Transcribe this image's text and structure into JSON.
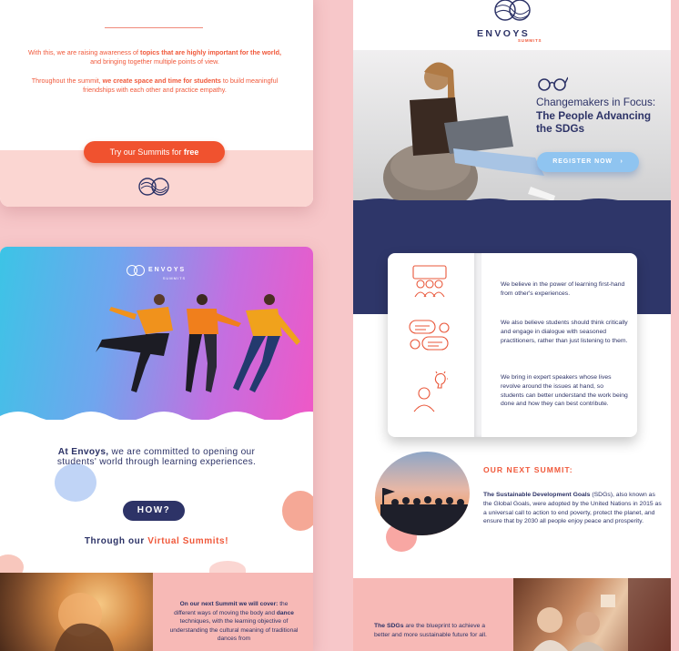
{
  "left_top": {
    "para1_pre": "With this, we are raising awareness of ",
    "para1_bold": "topics that are highly important for the world,",
    "para1_post": " and bringing together multiple points of view.",
    "para2_pre": "Throughout the summit, ",
    "para2_bold": "we create space and time for students",
    "para2_post": " to build meaningful friendships with each other and practice empathy.",
    "cta_pre": "Try our Summits for ",
    "cta_bold": "free"
  },
  "left_bottom": {
    "hero_brand": "ENVOYS",
    "hero_brand_sub": "SUMMITS",
    "committed_bold": "At Envoys,",
    "committed_rest": " we are committed to opening our students' world through learning experiences.",
    "how_label": "HOW?",
    "through_pre": "Through our ",
    "through_accent": "Virtual Summits!",
    "bottom_bold": "On our next Summit we will cover:",
    "bottom_pre": " the different ways of moving the body and ",
    "bottom_bold2": "dance",
    "bottom_post": " techniques, with the learning objective of understanding the cultural meaning of traditional dances from"
  },
  "right": {
    "brand": "ENVOYS",
    "brand_sub": "SUMMITS",
    "title_line": "Changemakers in Focus: ",
    "title_bold": "The People Advancing the SDGs",
    "register_label": "REGISTER NOW",
    "register_arrow": "›",
    "info_items": [
      "We believe in the power of learning first-hand from other's experiences.",
      "We also believe students should think critically and engage in dialogue with seasoned practitioners, rather than just listening to them.",
      "We bring in expert speakers whose lives revolve around the issues at hand, so students can better understand the work being done and how they can best contribute."
    ],
    "next_heading": "OUR NEXT SUMMIT:",
    "next_bold": "The Sustainable Development Goals",
    "next_rest": " (SDGs), also known as the Global Goals, were adopted by the United Nations in 2015 as a universal call to action to end poverty, protect the planet, and ensure that by 2030 all people enjoy peace and prosperity.",
    "sdgs_bold": "The SDGs",
    "sdgs_rest": " are the blueprint to achieve a better and more sustainable future for all."
  },
  "colors": {
    "background": "#f7c7c9",
    "navy": "#2d3367",
    "orange": "#f0583a",
    "light_blue_button": "#8fc4f0"
  },
  "icons": [
    "summit-logo-icon",
    "glasses-icon",
    "group-icon",
    "dialogue-icon",
    "speaker-idea-icon",
    "chevron-right-icon"
  ]
}
